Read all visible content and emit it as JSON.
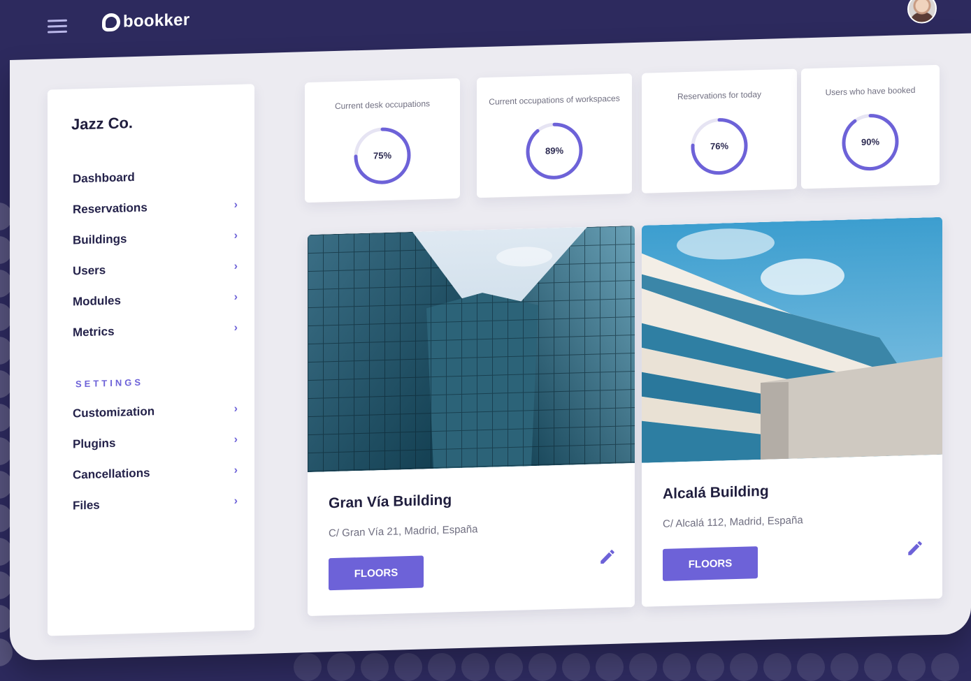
{
  "header": {
    "brand": "bookker",
    "menu_icon": "hamburger-menu-icon",
    "avatar": "user-avatar"
  },
  "sidebar": {
    "organization": "Jazz Co.",
    "items": [
      {
        "label": "Dashboard",
        "has_chevron": false
      },
      {
        "label": "Reservations",
        "has_chevron": true
      },
      {
        "label": "Buildings",
        "has_chevron": true
      },
      {
        "label": "Users",
        "has_chevron": true
      },
      {
        "label": "Modules",
        "has_chevron": true
      },
      {
        "label": "Metrics",
        "has_chevron": true
      }
    ],
    "settings_title": "SETTINGS",
    "settings_items": [
      {
        "label": "Customization",
        "has_chevron": true
      },
      {
        "label": "Plugins",
        "has_chevron": true
      },
      {
        "label": "Cancellations",
        "has_chevron": true
      },
      {
        "label": "Files",
        "has_chevron": true
      }
    ],
    "chevron_glyph": "›"
  },
  "stats": [
    {
      "title": "Current desk occupations",
      "value_label": "75%",
      "percent": 75
    },
    {
      "title": "Current occupations of workspaces",
      "value_label": "89%",
      "percent": 89
    },
    {
      "title": "Reservations for today",
      "value_label": "76%",
      "percent": 76
    },
    {
      "title": "Users who have booked",
      "value_label": "90%",
      "percent": 90
    }
  ],
  "buildings": [
    {
      "name": "Gran Vía Building",
      "address": "C/ Gran Vía 21, Madrid, España",
      "button": "FLOORS",
      "image": "glass-building-photo"
    },
    {
      "name": "Alcalá Building",
      "address": "C/ Alcalá 112, Madrid, España",
      "button": "FLOORS",
      "image": "terraced-building-photo"
    }
  ],
  "colors": {
    "primary": "#6d62d8",
    "header_bg": "#2d2a5e",
    "content_bg": "#ecebf1",
    "ring_track": "#e6e4f3"
  }
}
